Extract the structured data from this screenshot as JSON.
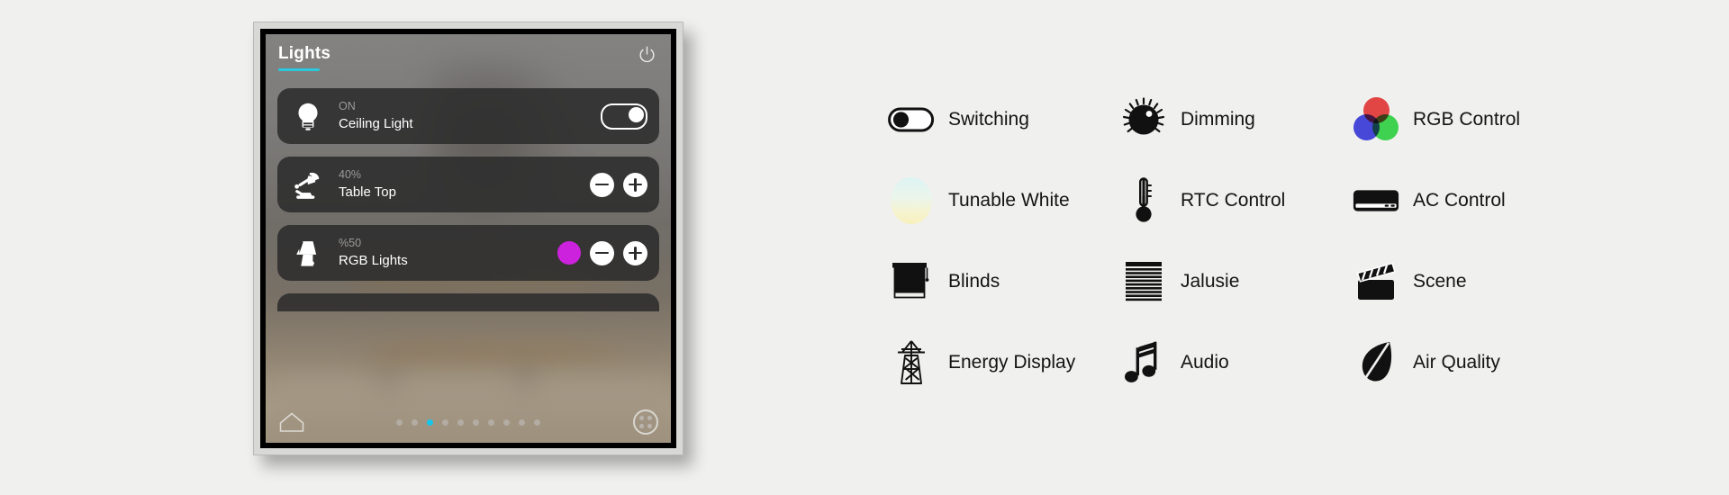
{
  "panel": {
    "header": {
      "title": "Lights",
      "power_icon": "power-icon"
    },
    "cards": [
      {
        "icon": "ceiling-bulb-icon",
        "state": "ON",
        "title": "Ceiling Light",
        "control": "toggle",
        "toggle_on": true
      },
      {
        "icon": "desk-lamp-icon",
        "state": "40%",
        "title": "Table Top",
        "control": "stepper"
      },
      {
        "icon": "table-lamp-icon",
        "state": "%50",
        "title": "RGB Lights",
        "control": "color-stepper",
        "color_swatch": "#cc22dd"
      }
    ],
    "bottom_bar": {
      "home_icon": "home-icon",
      "apps_icon": "apps-grid-icon",
      "dots_total": 10,
      "active_dot_index": 3,
      "active_dot_color": "#16c6ea"
    },
    "accent_color": "#2bc8de"
  },
  "legend": {
    "items": [
      {
        "icon": "toggle-switch-icon",
        "label": "Switching"
      },
      {
        "icon": "dimmer-knob-icon",
        "label": "Dimming"
      },
      {
        "icon": "rgb-circles-icon",
        "label": "RGB Control"
      },
      {
        "icon": "tunable-white-icon",
        "label": "Tunable White"
      },
      {
        "icon": "thermometer-icon",
        "label": "RTC Control"
      },
      {
        "icon": "air-conditioner-icon",
        "label": "AC Control"
      },
      {
        "icon": "blinds-icon",
        "label": "Blinds"
      },
      {
        "icon": "jalusie-icon",
        "label": "Jalusie"
      },
      {
        "icon": "clapperboard-icon",
        "label": "Scene"
      },
      {
        "icon": "power-pylon-icon",
        "label": "Energy Display"
      },
      {
        "icon": "music-note-icon",
        "label": "Audio"
      },
      {
        "icon": "leaf-icon",
        "label": "Air Quality"
      }
    ]
  }
}
